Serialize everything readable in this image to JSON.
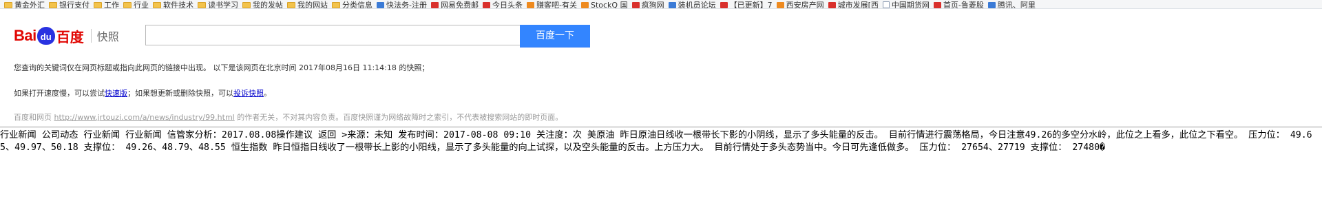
{
  "bookmarks": [
    {
      "label": "黄金外汇",
      "icon": "folder-icon"
    },
    {
      "label": "银行支付",
      "icon": "folder-icon"
    },
    {
      "label": "工作",
      "icon": "folder-icon"
    },
    {
      "label": "行业",
      "icon": "folder-icon"
    },
    {
      "label": "软件技术",
      "icon": "folder-icon"
    },
    {
      "label": "读书学习",
      "icon": "folder-icon"
    },
    {
      "label": "我的发帖",
      "icon": "folder-icon"
    },
    {
      "label": "我的网站",
      "icon": "folder-icon"
    },
    {
      "label": "分类信息",
      "icon": "folder-icon"
    },
    {
      "label": "快法务-注册",
      "icon": "blue-square-icon"
    },
    {
      "label": "网易免费邮",
      "icon": "red-square-icon"
    },
    {
      "label": "今日头条",
      "icon": "red-square-icon"
    },
    {
      "label": "赚客吧-有关",
      "icon": "orange-square-icon"
    },
    {
      "label": "StockQ 国",
      "icon": "orange-square-icon"
    },
    {
      "label": "疯狗网",
      "icon": "red-square-icon"
    },
    {
      "label": "装机员论坛",
      "icon": "blue-square-icon"
    },
    {
      "label": "【已更新】7",
      "icon": "red-square-icon"
    },
    {
      "label": "西安房产网",
      "icon": "orange-square-icon"
    },
    {
      "label": "城市发展[西",
      "icon": "red-square-icon"
    },
    {
      "label": "中国期货网",
      "icon": "page-icon"
    },
    {
      "label": "首页-鲁菱股",
      "icon": "red-square-icon"
    },
    {
      "label": "腾讯、阿里",
      "icon": "blue-square-icon"
    }
  ],
  "header": {
    "logo_bai": "Bai",
    "logo_paw": "du",
    "logo_du": "百度",
    "logo_kuaizhao": "快照",
    "search_value": "",
    "search_button": "百度一下"
  },
  "notice": {
    "line1": "您查询的关键词仅在网页标题或指向此网页的链接中出现。    以下是该网页在北京时间 2017年08月16日 11:14:18 的快照；",
    "line2_prefix": "如果打开速度慢，可以尝试",
    "line2_link1": "快速版",
    "line2_middle": "；如果想更新或删除快照，可以",
    "line2_link2": "投诉快照",
    "line2_suffix": "。",
    "line3_prefix": "百度和网页 ",
    "line3_url": "http://www.jrtouzi.com/a/news/industry/99.html",
    "line3_suffix": " 的作者无关，不对其内容负责。百度快照谨为网络故障时之索引，不代表被搜索网站的即时页面。"
  },
  "article": {
    "text": "行业新闻 公司动态 行业新闻 行业新闻 信管家分析：2017.08.08操作建议 返回 >来源：未知 发布时间：2017-08-08 09:10 关注度：次 美原油 昨日原油日线收一根带长下影的小阴线，显示了多头能量的反击。 目前行情进行震荡格局，今日注意49.26的多空分水岭，此位之上看多，此位之下看空。 压力位： 49.65、49.97、50.18 支撑位： 49.26、48.79、48.55 恒生指数 昨日恒指日线收了一根带长上影的小阳线，显示了多头能量的向上试探，以及空头能量的反击。上方压力大。 目前行情处于多头态势当中。今日可先逢低做多。 压力位： 27654、27719 支撑位： 27480�"
  }
}
